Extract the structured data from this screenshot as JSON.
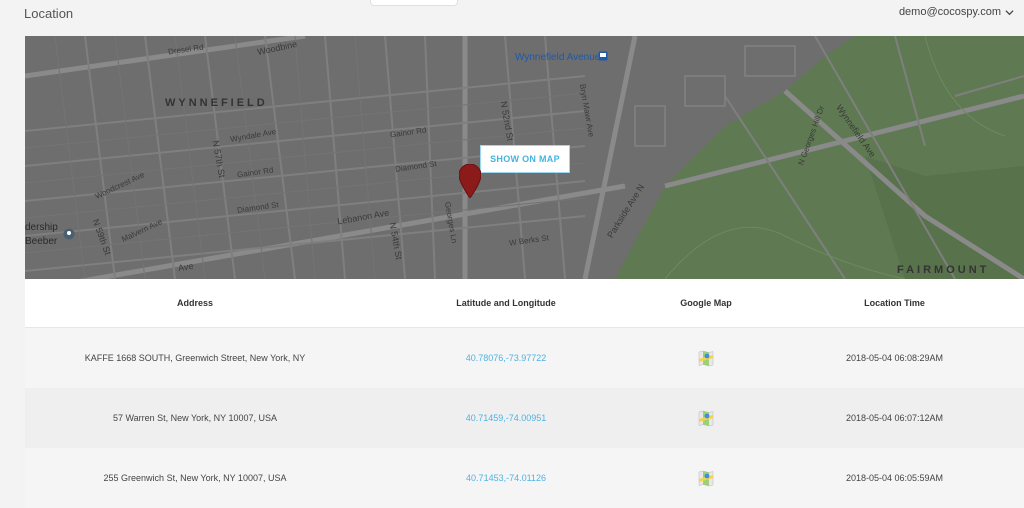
{
  "header": {
    "title": "Location",
    "user_email": "demo@cocospy.com"
  },
  "map": {
    "show_button": "SHOW ON MAP",
    "labels": {
      "wynnefield": "WYNNEFIELD",
      "fairmount": "FAIRMOUNT",
      "wynnefield_avenue": "Wynnefield Avenue",
      "dresel_rd": "Dresel Rd",
      "woodbine": "Woodbine",
      "lebanon_ave": "Lebanon Ave",
      "parkside_ave": "Parkside Ave N",
      "bryn_mawr": "Bryn Mawr Ave",
      "n52nd": "N 52nd St",
      "n54th": "N 54th St",
      "n57th": "N 57th St",
      "n59th": "N 59th St",
      "gainor_rd": "Gainor Rd",
      "diamond_st": "Diamond St",
      "wyndale_ave": "Wyndale Ave",
      "woodcrest_ave": "Woodcrest Ave",
      "malvern_ave": "Malvern Ave",
      "w_berks_st": "W Berks St",
      "wynnefield_ave_diag": "Wynnefield Ave",
      "n_georges_hill": "N Georges Hill Dr",
      "leadership": "dership",
      "beeber": "Beeber",
      "georges_ln": "Georges Ln",
      "ave": "Ave"
    }
  },
  "table": {
    "headers": [
      "Address",
      "Latitude and Longitude",
      "Google Map",
      "Location Time"
    ],
    "rows": [
      {
        "address": "KAFFE 1668 SOUTH, Greenwich Street, New York, NY",
        "latlng": "40.78076,-73.97722",
        "time": "2018-05-04  06:08:29AM"
      },
      {
        "address": "57 Warren St, New York, NY 10007, USA",
        "latlng": "40.71459,-74.00951",
        "time": "2018-05-04  06:07:12AM"
      },
      {
        "address": "255 Greenwich St, New York, NY 10007, USA",
        "latlng": "40.71453,-74.01126",
        "time": "2018-05-04  06:05:59AM"
      }
    ]
  },
  "colors": {
    "accent": "#4fb3e3",
    "map_bg": "#707070",
    "park": "#5f7a52",
    "pin": "#8b1a1a"
  }
}
